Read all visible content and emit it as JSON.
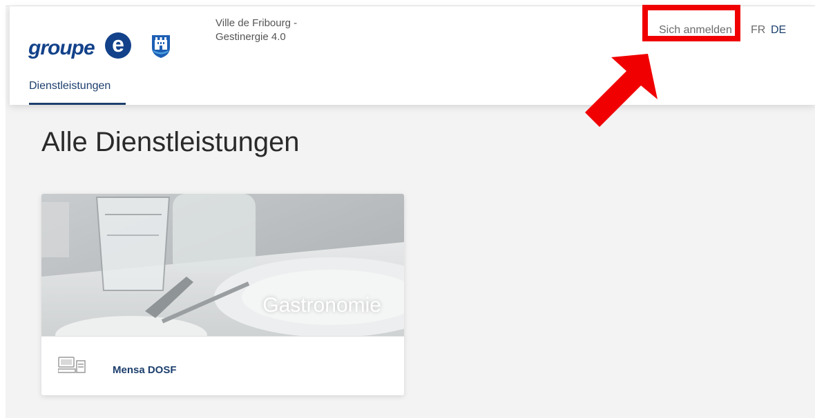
{
  "brand": {
    "logo_text": "groupe",
    "logo_letter": "e"
  },
  "site": {
    "name_line1": "Ville de Fribourg -",
    "name_line2": "Gestinergie 4.0"
  },
  "nav": {
    "tab": "Dienstleistungen"
  },
  "header_actions": {
    "login": "Sich anmelden",
    "lang_fr": "FR",
    "lang_de": "DE"
  },
  "page": {
    "title": "Alle Dienstleistungen"
  },
  "card": {
    "category": "Gastronomie",
    "service_name": "Mensa DOSF",
    "service_icon": "computer-register-icon"
  },
  "colors": {
    "brand_blue": "#13428a",
    "highlight_red": "#f00000",
    "background": "#f3f3f4"
  }
}
